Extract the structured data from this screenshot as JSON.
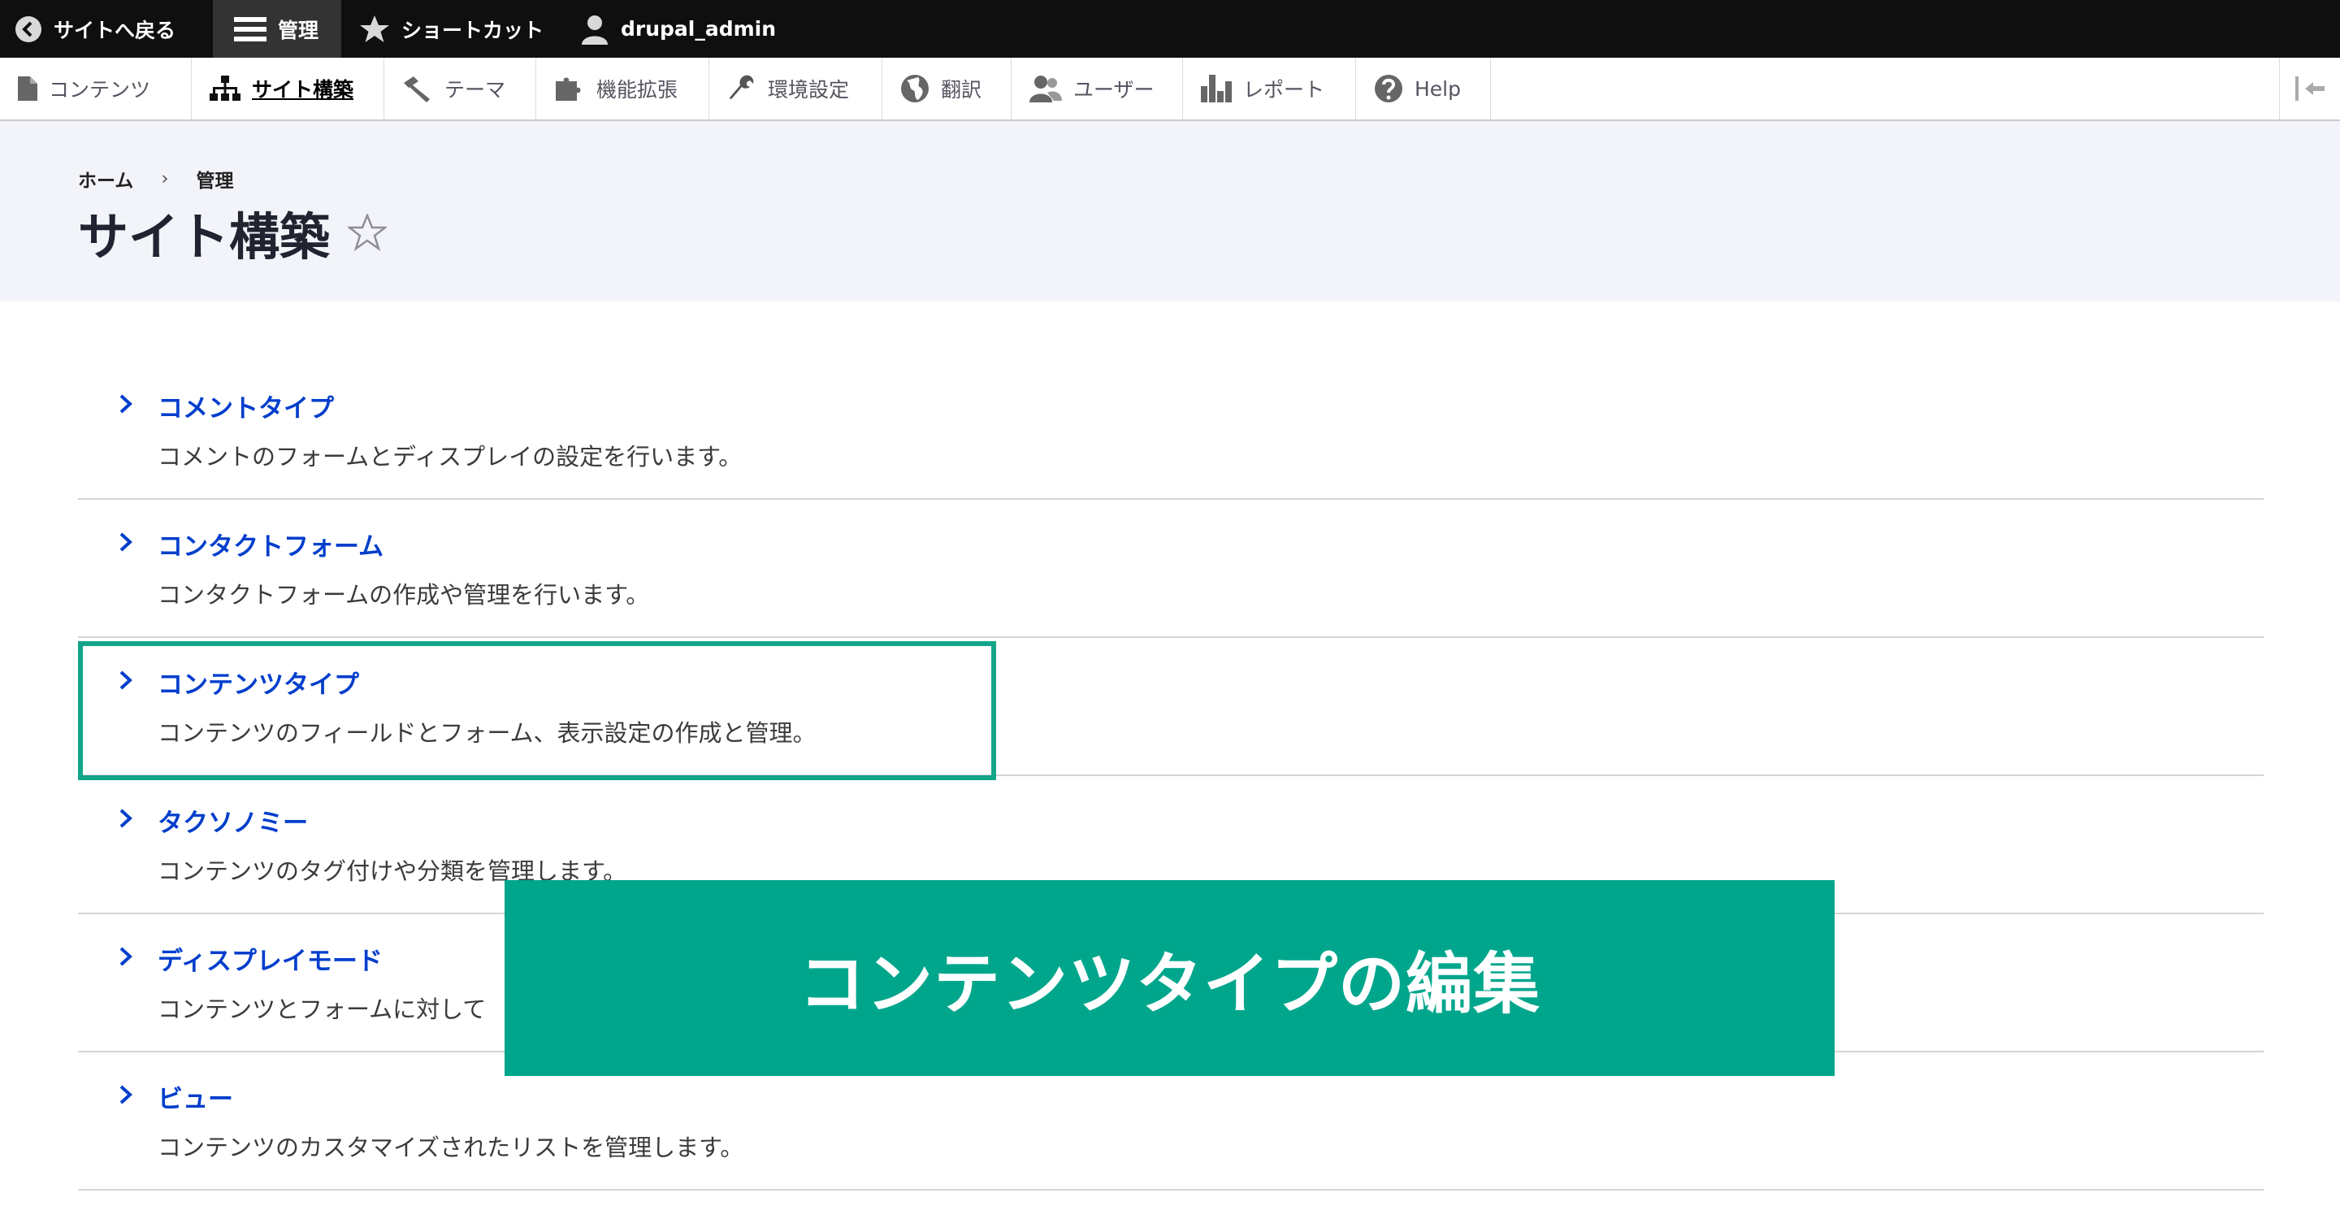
{
  "toolbar": {
    "back_label": "サイトへ戻る",
    "manage_label": "管理",
    "shortcuts_label": "ショートカット",
    "user_label": "drupal_admin"
  },
  "tray": {
    "items": [
      {
        "label": "コンテンツ",
        "icon": "document-icon"
      },
      {
        "label": "サイト構築",
        "icon": "sitemap-icon"
      },
      {
        "label": "テーマ",
        "icon": "paintbrush-icon"
      },
      {
        "label": "機能拡張",
        "icon": "puzzle-icon"
      },
      {
        "label": "環境設定",
        "icon": "wrench-icon"
      },
      {
        "label": "翻訳",
        "icon": "globe-icon"
      },
      {
        "label": "ユーザー",
        "icon": "users-icon"
      },
      {
        "label": "レポート",
        "icon": "bar-chart-icon"
      },
      {
        "label": "Help",
        "icon": "help-icon"
      }
    ],
    "active_index": 1
  },
  "breadcrumb": {
    "home": "ホーム",
    "separator": "›",
    "manage": "管理"
  },
  "page": {
    "title": "サイト構築"
  },
  "admin_items": [
    {
      "title": "コメントタイプ",
      "description": "コメントのフォームとディスプレイの設定を行います。"
    },
    {
      "title": "コンタクトフォーム",
      "description": "コンタクトフォームの作成や管理を行います。"
    },
    {
      "title": "コンテンツタイプ",
      "description": "コンテンツのフィールドとフォーム、表示設定の作成と管理。"
    },
    {
      "title": "タクソノミー",
      "description": "コンテンツのタグ付けや分類を管理します。"
    },
    {
      "title": "ディスプレイモード",
      "description": "コンテンツとフォームに対して"
    },
    {
      "title": "ビュー",
      "description": "コンテンツのカスタマイズされたリストを管理します。"
    }
  ],
  "overlay": {
    "text": "コンテンツタイプの編集"
  },
  "colors": {
    "link": "#003ecc",
    "accent": "#00a68c",
    "toolbar": "#0f0f0f"
  }
}
